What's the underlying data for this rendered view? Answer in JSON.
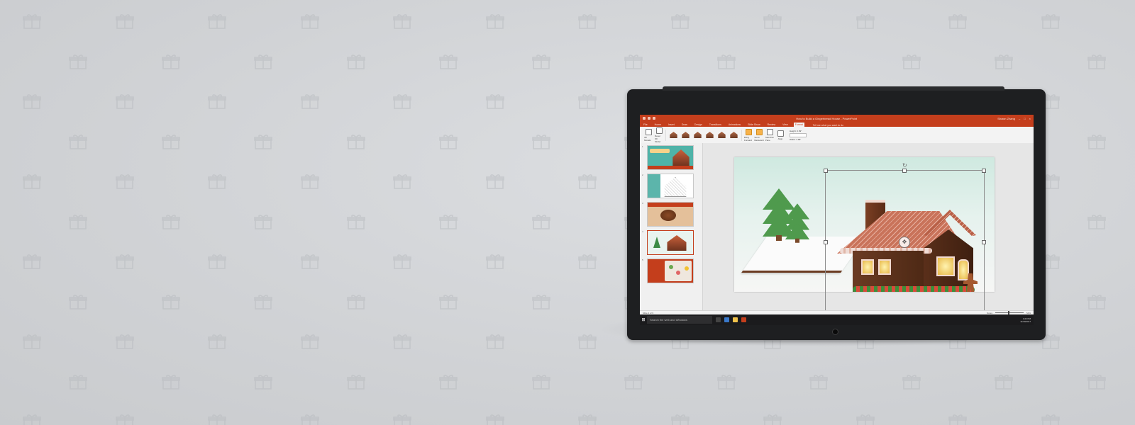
{
  "window": {
    "title": "How to Build a Gingerbread House - PowerPoint",
    "file_name": "HowToBuildAGingerbreadHouse",
    "user": "Shawn Zhang"
  },
  "tabs": [
    "File",
    "Home",
    "Insert",
    "Draw",
    "Design",
    "Transitions",
    "Animations",
    "Slide Show",
    "Review",
    "View",
    "Format"
  ],
  "active_tab": "Format",
  "tell_me": "Tell me what you want to do",
  "ribbon": {
    "group_3d_models": "3D Models",
    "reset_label": "Reset 3D Model",
    "gallery_label": "3D Model Views",
    "bring_forward": "Bring Forward",
    "send_backward": "Send Backward",
    "selection_pane": "Selection Pane",
    "align": "Align",
    "arrange_label": "Arrange",
    "height_label": "Height: 2.69\"",
    "width_label": "Width: 3.68\"",
    "size_label": "Size"
  },
  "thumbnails": [
    {
      "num": "1"
    },
    {
      "num": "2"
    },
    {
      "num": "3"
    },
    {
      "num": "4"
    },
    {
      "num": "5"
    }
  ],
  "selected_slide": 4,
  "statusbar": {
    "slide_info": "Slide 4 of 9",
    "notes": "Notes",
    "zoom": "54%"
  },
  "taskbar": {
    "search_placeholder": "Search the web and Windows",
    "time": "4:22 PM",
    "date": "11/30/2017"
  },
  "colors": {
    "accent": "#c43e1c",
    "background": "#d3d5d8",
    "bezel": "#1e1f21"
  }
}
